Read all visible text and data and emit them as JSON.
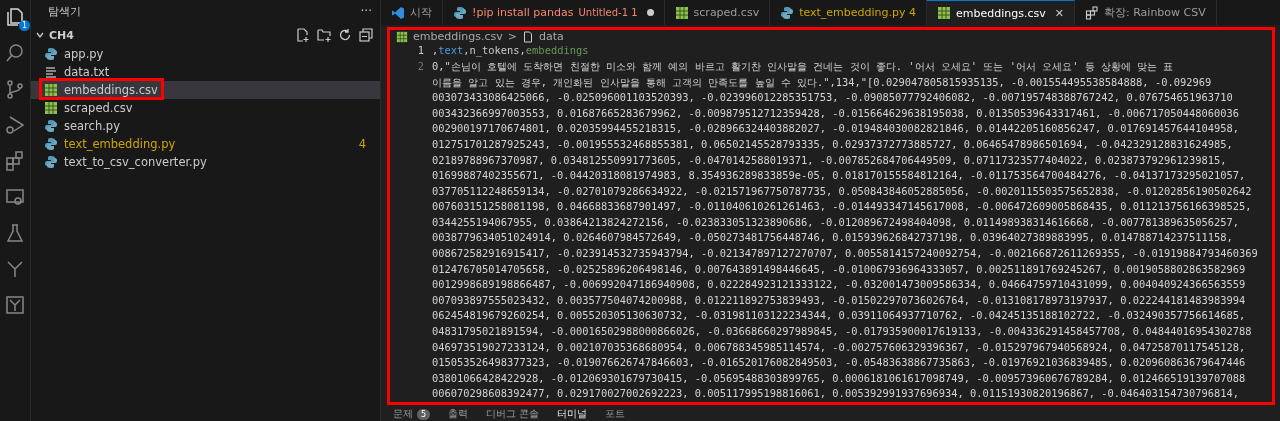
{
  "activity_bar": {
    "items": [
      {
        "kind": "explorer",
        "selected": true,
        "badge": "1"
      },
      {
        "kind": "search",
        "selected": false
      },
      {
        "kind": "source-control",
        "selected": false
      },
      {
        "kind": "debug",
        "selected": false
      },
      {
        "kind": "extensions",
        "selected": false
      },
      {
        "kind": "remote",
        "selected": false
      },
      {
        "kind": "testing",
        "selected": false
      },
      {
        "kind": "tree",
        "selected": false
      },
      {
        "kind": "tree-box",
        "selected": false
      }
    ]
  },
  "sidebar": {
    "title": "탐색기",
    "more": "···",
    "folder": {
      "name": "CH4",
      "expanded": true
    },
    "files": [
      {
        "name": "app.py",
        "kind": "python",
        "selected": false,
        "highlighted": false
      },
      {
        "name": "data.txt",
        "kind": "text",
        "selected": false,
        "highlighted": false
      },
      {
        "name": "embeddings.csv",
        "kind": "csv",
        "selected": true,
        "highlighted": true
      },
      {
        "name": "scraped.csv",
        "kind": "csv",
        "selected": false,
        "highlighted": false
      },
      {
        "name": "search.py",
        "kind": "python",
        "selected": false,
        "highlighted": false
      },
      {
        "name": "text_embedding.py",
        "kind": "python",
        "selected": false,
        "highlighted": false,
        "warning": true,
        "badge": "4"
      },
      {
        "name": "text_to_csv_converter.py",
        "kind": "python",
        "selected": false,
        "highlighted": false
      }
    ]
  },
  "tabs": [
    {
      "kind": "welcome",
      "label": "시작",
      "selected": false
    },
    {
      "kind": "python",
      "label": "!pip install pandas",
      "detail": "Untitled-1 1",
      "error": true,
      "dirty": true,
      "selected": false
    },
    {
      "kind": "csv",
      "label": "scraped.csv",
      "selected": false
    },
    {
      "kind": "python",
      "label": "text_embedding.py 4",
      "warning": true,
      "selected": false
    },
    {
      "kind": "csv",
      "label": "embeddings.csv",
      "selected": true,
      "close": "✕"
    },
    {
      "kind": "extension",
      "label": "확장: Rainbow CSV",
      "selected": false
    }
  ],
  "editor": {
    "highlighted": true,
    "breadcrumb": [
      "embeddings.csv",
      "data"
    ],
    "breadcrumb_separator": ">",
    "lines": [
      {
        "number": "1",
        "current": true,
        "segments": [
          {
            "text": ",",
            "kind": "plain"
          },
          {
            "text": "text",
            "kind": "keyword"
          },
          {
            "text": ",n_tokens,",
            "kind": "plain"
          },
          {
            "text": "embeddings",
            "kind": "string"
          }
        ]
      },
      {
        "number": "2",
        "current": false,
        "rows": [
          "0,\"손님이 호텔에 도착하면 친절한 미소와 함께 예의 바르고 활기찬 인사말을 건네는 것이 좋다. '어서 오세요' 또는 '어서 오세요' 등 상황에 맞는 표",
          "이름을 알고 있는 경우, 개인화된 인사말을 통해 고객의 만족도를 높일 수 있다.\",134,\"[0.029047805815935135, -0.001554495538584888, -0.092969",
          "003073433086425066, -0.025096001103520393, -0.023996012285351753, -0.09085077792406082, -0.007195748388767242, 0.076754651963710",
          "003432366997003553, 0.01687665283679962, -0.009879512712359428, -0.015664629638195038, 0.01350539643317461, -0.006717050448060036",
          "002900197170674801, 0.02035994455218315, -0.028966324403882027, -0.019484030082821846, 0.01442205160856247, 0.017691457644104958,",
          "012751701287925243, -0.001955532468855381, 0.06502145528793335, 0.02937372773885727, 0.06465478986501694, -0.042329128831624985,",
          "02189788967370987, 0.034812550991773605, -0.0470142588019371, -0.007852684706449509, 0.07117323577404022, 0.023873792961239815,",
          "01699887402355671, -0.04420318081974983, 8.354936289833859e-05, 0.018170155584812164, -0.011753564700484276, -0.04137173295021057,",
          "037705112248659134, -0.02701079286634922, -0.021571967750787735, 0.050843846052885056, -0.0020115503575652838, -0.01202856190502642",
          "007603151258081198, 0.04668833687901497, -0.011040610261261463, -0.014493347145617008, -0.006472609005868435, 0.011213756166398525,",
          "0344255194067955, 0.03864213824272156, -0.023833051323890686, -0.012089672498404098, 0.011498938314616668, -0.007781389635056257,",
          "0038779634051024914, 0.0264607984572649, -0.050273481756448746, 0.015939626842737198, 0.03964027389883995, 0.014788714237511158,",
          "008672582916915417, -0.023914532735943794, -0.021347897127270707, 0.0055814157240092754, -0.002166872611269355, -0.01919884793460369",
          "012476705014705658, -0.02525896206498146, 0.007643891498446645, -0.010067936964333057, 0.002511891769245267, 0.0019058802863582969",
          "0012998689198866487, -0.006992047186940908, 0.022284923121333122, -0.032001473009586334, 0.04664759710431099, 0.004040924366563559",
          "007093897555023432, 0.003577504074200988, 0.012211892753839493, -0.015022970736026764, -0.013108178973197937, 0.022244181483983994",
          "062454819679260254, 0.005520305130630732, -0.031981103122234344, 0.03911064937710762, -0.04245135188102722, -0.032490357756614685,",
          "04831795021891594, -0.00016502988000866026, -0.03668660297989845, -0.017935900017619133, -0.004336291458457708, 0.04844016954302788",
          "046973519027233124, 0.002107035368680954, 0.006788345985114574, -0.002757606329396367, -0.015297967940568924, 0.04725870117545128,",
          "015053526498377323, -0.019076626747846603, -0.016520176082849503, -0.05483638867735863, -0.01976921036839485, 0.020960863679647446",
          "03801066428422928, -0.012069301679730415, -0.05695488303899765, 0.0006181061617098749, -0.009573960676789284, 0.012466519139707088",
          "006070298608392477, 0.029170027002692223, 0.005117995198816061, 0.005392991937696934, 0.01151930820196867, -0.046403154730796814,"
        ]
      }
    ]
  },
  "panel": {
    "tabs": [
      {
        "label": "문제",
        "badge": "5",
        "selected": false
      },
      {
        "label": "출력",
        "selected": false
      },
      {
        "label": "디버그 콘솔",
        "selected": false
      },
      {
        "label": "터미널",
        "selected": true
      },
      {
        "label": "포트",
        "selected": false
      }
    ]
  }
}
